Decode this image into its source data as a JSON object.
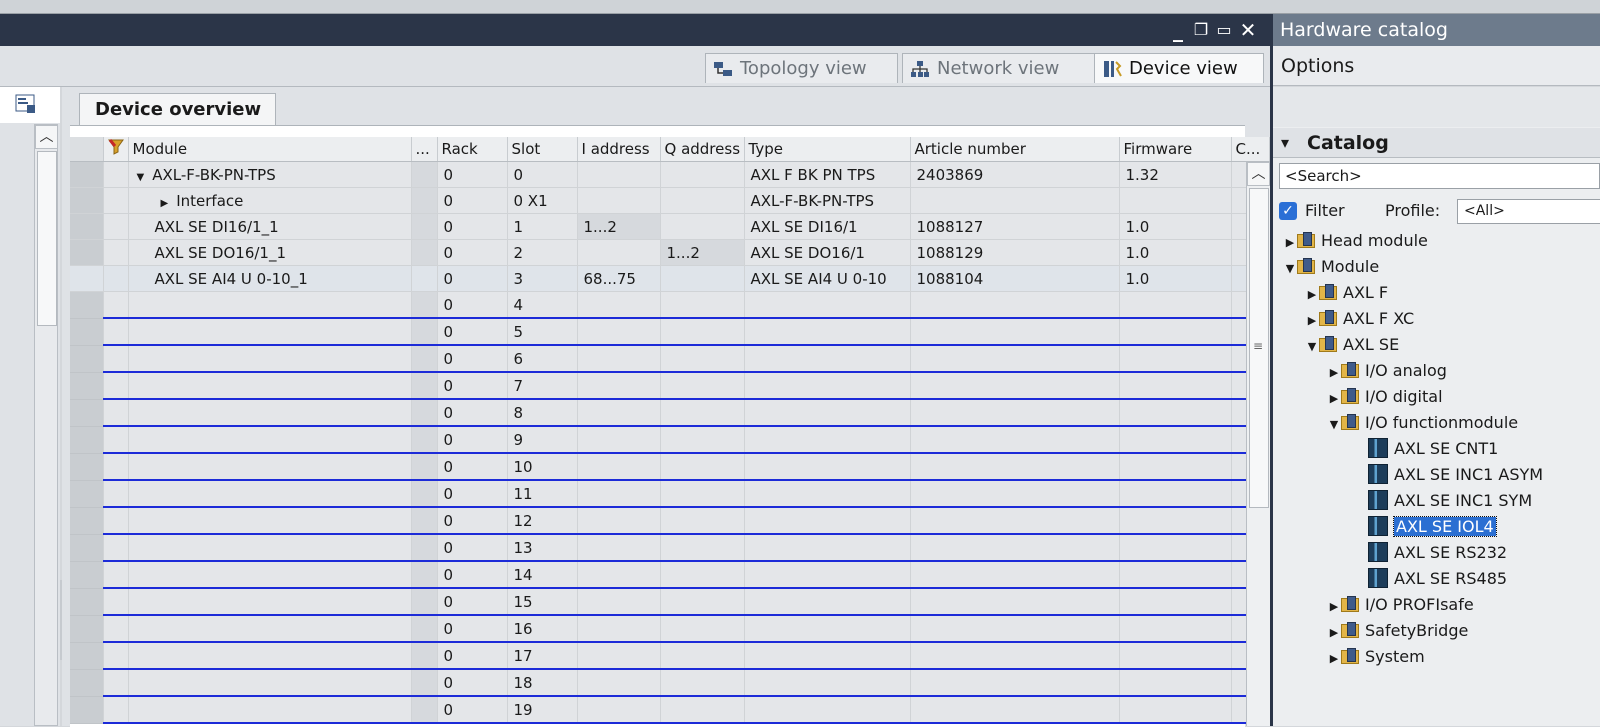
{
  "window": {
    "buttons": [
      "_",
      "❐",
      "▭",
      "✕"
    ]
  },
  "views": {
    "topology": "Topology view",
    "network": "Network view",
    "device": "Device view"
  },
  "device_overview": {
    "tab_label": "Device overview",
    "columns": [
      "Module",
      "...",
      "Rack",
      "Slot",
      "I address",
      "Q address",
      "Type",
      "Article number",
      "Firmware",
      "C..."
    ],
    "rows": [
      {
        "module": "AXL-F-BK-PN-TPS",
        "rack": "0",
        "slot": "0",
        "i_address": "",
        "q_address": "",
        "type": "AXL F BK PN TPS",
        "article": "2403869",
        "firmware": "1.32"
      },
      {
        "module": "Interface",
        "rack": "0",
        "slot": "0 X1",
        "i_address": "",
        "q_address": "",
        "type": "AXL-F-BK-PN-TPS",
        "article": "",
        "firmware": ""
      },
      {
        "module": "AXL SE DI16/1_1",
        "rack": "0",
        "slot": "1",
        "i_address": "1...2",
        "q_address": "",
        "type": "AXL SE DI16/1",
        "article": "1088127",
        "firmware": "1.0"
      },
      {
        "module": "AXL SE DO16/1_1",
        "rack": "0",
        "slot": "2",
        "i_address": "",
        "q_address": "1...2",
        "type": "AXL SE DO16/1",
        "article": "1088129",
        "firmware": "1.0"
      },
      {
        "module": "AXL SE AI4 U 0-10_1",
        "rack": "0",
        "slot": "3",
        "i_address": "68...75",
        "q_address": "",
        "type": "AXL SE AI4 U 0-10",
        "article": "1088104",
        "firmware": "1.0"
      },
      {
        "module": "",
        "rack": "0",
        "slot": "4",
        "i_address": "",
        "q_address": "",
        "type": "",
        "article": "",
        "firmware": ""
      },
      {
        "module": "",
        "rack": "0",
        "slot": "5",
        "i_address": "",
        "q_address": "",
        "type": "",
        "article": "",
        "firmware": ""
      },
      {
        "module": "",
        "rack": "0",
        "slot": "6",
        "i_address": "",
        "q_address": "",
        "type": "",
        "article": "",
        "firmware": ""
      },
      {
        "module": "",
        "rack": "0",
        "slot": "7",
        "i_address": "",
        "q_address": "",
        "type": "",
        "article": "",
        "firmware": ""
      },
      {
        "module": "",
        "rack": "0",
        "slot": "8",
        "i_address": "",
        "q_address": "",
        "type": "",
        "article": "",
        "firmware": ""
      },
      {
        "module": "",
        "rack": "0",
        "slot": "9",
        "i_address": "",
        "q_address": "",
        "type": "",
        "article": "",
        "firmware": ""
      },
      {
        "module": "",
        "rack": "0",
        "slot": "10",
        "i_address": "",
        "q_address": "",
        "type": "",
        "article": "",
        "firmware": ""
      },
      {
        "module": "",
        "rack": "0",
        "slot": "11",
        "i_address": "",
        "q_address": "",
        "type": "",
        "article": "",
        "firmware": ""
      },
      {
        "module": "",
        "rack": "0",
        "slot": "12",
        "i_address": "",
        "q_address": "",
        "type": "",
        "article": "",
        "firmware": ""
      },
      {
        "module": "",
        "rack": "0",
        "slot": "13",
        "i_address": "",
        "q_address": "",
        "type": "",
        "article": "",
        "firmware": ""
      },
      {
        "module": "",
        "rack": "0",
        "slot": "14",
        "i_address": "",
        "q_address": "",
        "type": "",
        "article": "",
        "firmware": ""
      },
      {
        "module": "",
        "rack": "0",
        "slot": "15",
        "i_address": "",
        "q_address": "",
        "type": "",
        "article": "",
        "firmware": ""
      },
      {
        "module": "",
        "rack": "0",
        "slot": "16",
        "i_address": "",
        "q_address": "",
        "type": "",
        "article": "",
        "firmware": ""
      },
      {
        "module": "",
        "rack": "0",
        "slot": "17",
        "i_address": "",
        "q_address": "",
        "type": "",
        "article": "",
        "firmware": ""
      },
      {
        "module": "",
        "rack": "0",
        "slot": "18",
        "i_address": "",
        "q_address": "",
        "type": "",
        "article": "",
        "firmware": ""
      },
      {
        "module": "",
        "rack": "0",
        "slot": "19",
        "i_address": "",
        "q_address": "",
        "type": "",
        "article": "",
        "firmware": ""
      }
    ]
  },
  "catalog": {
    "title": "Hardware catalog",
    "options": "Options",
    "section": "Catalog",
    "search_placeholder": "<Search>",
    "filter_label": "Filter",
    "profile_label": "Profile:",
    "profile_value": "<All>",
    "tree": {
      "head_module": "Head module",
      "module": "Module",
      "axl_f": "AXL F",
      "axl_f_xc": "AXL F XC",
      "axl_se": "AXL SE",
      "io_analog": "I/O analog",
      "io_digital": "I/O digital",
      "io_function": "I/O functionmodule",
      "cnt1": "AXL SE CNT1",
      "inc1_asym": "AXL SE INC1 ASYM",
      "inc1_sym": "AXL SE INC1 SYM",
      "iol4": "AXL SE IOL4",
      "rs232": "AXL SE RS232",
      "rs485": "AXL SE RS485",
      "io_profisafe": "I/O PROFIsafe",
      "safetybridge": "SafetyBridge",
      "system": "System"
    }
  },
  "colors": {
    "titlebar": "#2b3548",
    "catalog_title": "#6d7b8c",
    "empty_slot_line": "#1c2bd8",
    "selection": "#2b6fd2"
  }
}
